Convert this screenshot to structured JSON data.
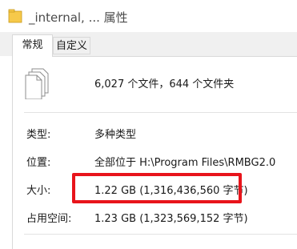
{
  "window": {
    "title": "_internal, ... 属性",
    "title_icon": "folder-icon"
  },
  "tabs": [
    {
      "label": "常规",
      "active": true
    },
    {
      "label": "自定义",
      "active": false
    }
  ],
  "general": {
    "icon": "multiple-documents-icon",
    "summary": "6,027 个文件，644 个文件夹",
    "type_label": "类型:",
    "type_value": "多种类型",
    "location_label": "位置:",
    "location_value": "全部位于 H:\\Program Files\\RMBG2.0",
    "size_label": "大小:",
    "size_value": "1.22 GB (1,316,436,560 字节)",
    "size_on_disk_label": "占用空间:",
    "size_on_disk_value": "1.23 GB (1,323,569,152 字节)"
  },
  "colors": {
    "highlight": "#e8141b",
    "folder": "#f6c94a"
  }
}
